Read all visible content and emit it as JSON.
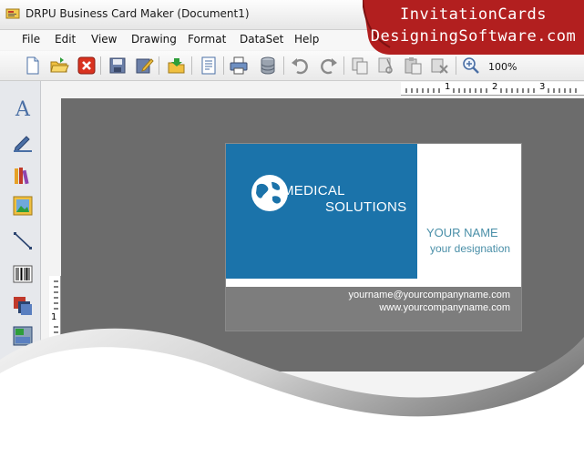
{
  "window": {
    "title": "DRPU Business Card Maker (Document1)"
  },
  "menu": {
    "items": [
      "File",
      "Edit",
      "View",
      "Drawing",
      "Format",
      "DataSet",
      "Help"
    ]
  },
  "toolbar": {
    "zoom_label": "100%",
    "buttons": [
      "new-document-icon",
      "open-folder-icon",
      "close-icon",
      "save-icon",
      "edit-icon",
      "open-icon",
      "properties-icon",
      "print-icon",
      "database-icon",
      "undo-icon",
      "redo-icon",
      "copy-icon",
      "cut-icon",
      "paste-icon",
      "delete-icon",
      "zoom-icon"
    ]
  },
  "ruler": {
    "top_numbers": [
      "1",
      "2",
      "3"
    ],
    "left_number": "1"
  },
  "sidebar": {
    "tools": [
      "text-tool-icon",
      "pencil-icon",
      "library-icon",
      "image-icon",
      "line-icon",
      "barcode-icon",
      "shapes-icon",
      "picture-icon"
    ]
  },
  "card": {
    "line1": "MEDICAL",
    "line2": "SOLUTIONS",
    "name": "YOUR NAME",
    "designation": "your designation",
    "email": "yourname@yourcompanyname.com",
    "website": "www.yourcompanyname.com"
  },
  "brand": {
    "line1": "InvitationCards",
    "line2": "DesigningSoftware.com"
  },
  "colors": {
    "card_blue": "#1b73aa",
    "card_gray": "#7d7d7d",
    "canvas": "#6c6c6c",
    "brand_red": "#b21f1f",
    "accent_text": "#4a8fa8"
  }
}
